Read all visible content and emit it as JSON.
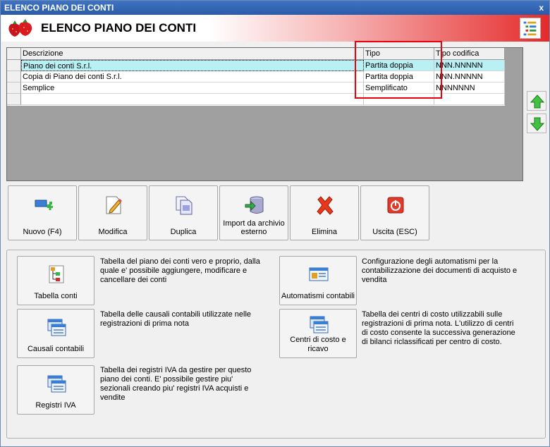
{
  "window": {
    "title": "ELENCO PIANO DEI CONTI",
    "close_glyph": "x"
  },
  "header": {
    "title": "ELENCO PIANO DEI CONTI",
    "logo_icon": "strawberry-logo-icon",
    "doc_icon": "document-list-icon"
  },
  "grid": {
    "columns": [
      "Descrizione",
      "Tipo",
      "Tipo codifica"
    ],
    "rows": [
      {
        "descrizione": "Piano dei conti S.r.l.",
        "tipo": "Partita doppia",
        "codifica": "NNN.NNNNN",
        "selected": true
      },
      {
        "descrizione": "Copia di Piano dei conti S.r.l.",
        "tipo": "Partita doppia",
        "codifica": "NNN.NNNNN",
        "selected": false
      },
      {
        "descrizione": "Semplice",
        "tipo": "Semplificato",
        "codifica": "NNNNNNN",
        "selected": false
      }
    ],
    "highlight_color": "#e8000c",
    "selected_color": "#b8f0f4"
  },
  "nav": {
    "up_icon": "green-up-arrow-icon",
    "down_icon": "green-down-arrow-icon"
  },
  "toolbar": {
    "nuovo": "Nuovo (F4)",
    "modifica": "Modifica",
    "duplica": "Duplica",
    "import_line1": "Import da archivio",
    "import_line2": "esterno",
    "elimina": "Elimina",
    "uscita": "Uscita (ESC)"
  },
  "panel": {
    "tabella_conti": {
      "label": "Tabella conti",
      "desc": "Tabella del piano dei conti vero e proprio, dalla quale e' possibile aggiungere, modificare e cancellare dei conti"
    },
    "causali": {
      "label": "Causali contabili",
      "desc": "Tabella delle causali contabili utilizzate nelle registrazioni di prima nota"
    },
    "registri": {
      "label": "Registri IVA",
      "desc": "Tabella dei registri IVA da gestire per questo piano dei conti. E' possibile gestire piu' sezionali creando piu' registri IVA acquisti e vendite"
    },
    "automatismi": {
      "label": "Automatismi contabili",
      "desc": "Configurazione degli automatismi per la contabilizzazione dei documenti di acquisto e vendita"
    },
    "centri": {
      "label_line1": "Centri di costo e",
      "label_line2": "ricavo",
      "desc": "Tabella dei centri di costo utilizzabili sulle registrazioni di prima nota. L'utilizzo di centri di costo consente la successiva generazione di bilanci riclassificati per centro di costo."
    }
  }
}
